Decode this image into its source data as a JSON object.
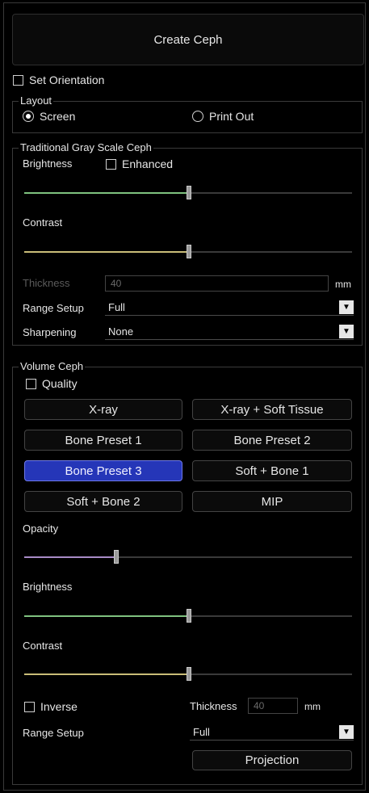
{
  "create_button": "Create Ceph",
  "set_orientation": "Set Orientation",
  "layout": {
    "title": "Layout",
    "options": [
      "Screen",
      "Print Out"
    ],
    "selected": "Screen"
  },
  "gray_scale": {
    "title": "Traditional Gray Scale Ceph",
    "brightness_label": "Brightness",
    "enhanced_label": "Enhanced",
    "brightness_value": 0.5,
    "contrast_label": "Contrast",
    "contrast_value": 0.5,
    "thickness_label": "Thickness",
    "thickness_value": "40",
    "thickness_unit": "mm",
    "range_setup_label": "Range Setup",
    "range_setup_value": "Full",
    "sharpening_label": "Sharpening",
    "sharpening_value": "None"
  },
  "volume": {
    "title": "Volume Ceph",
    "quality_label": "Quality",
    "presets": [
      "X-ray",
      "X-ray + Soft Tissue",
      "Bone Preset 1",
      "Bone Preset 2",
      "Bone Preset 3",
      "Soft + Bone 1",
      "Soft + Bone 2",
      "MIP"
    ],
    "active_preset": "Bone Preset 3",
    "opacity_label": "Opacity",
    "opacity_value": 0.28,
    "brightness_label": "Brightness",
    "brightness_value": 0.5,
    "contrast_label": "Contrast",
    "contrast_value": 0.5,
    "inverse_label": "Inverse",
    "thickness_label": "Thickness",
    "thickness_value": "40",
    "thickness_unit": "mm",
    "range_setup_label": "Range Setup",
    "range_setup_value": "Full",
    "projection_button": "Projection"
  },
  "colors": {
    "brightness_fill": "#7fc27f",
    "contrast_fill": "#c9bd78",
    "opacity_fill": "#a88bc7",
    "active_button": "#2536b8"
  }
}
